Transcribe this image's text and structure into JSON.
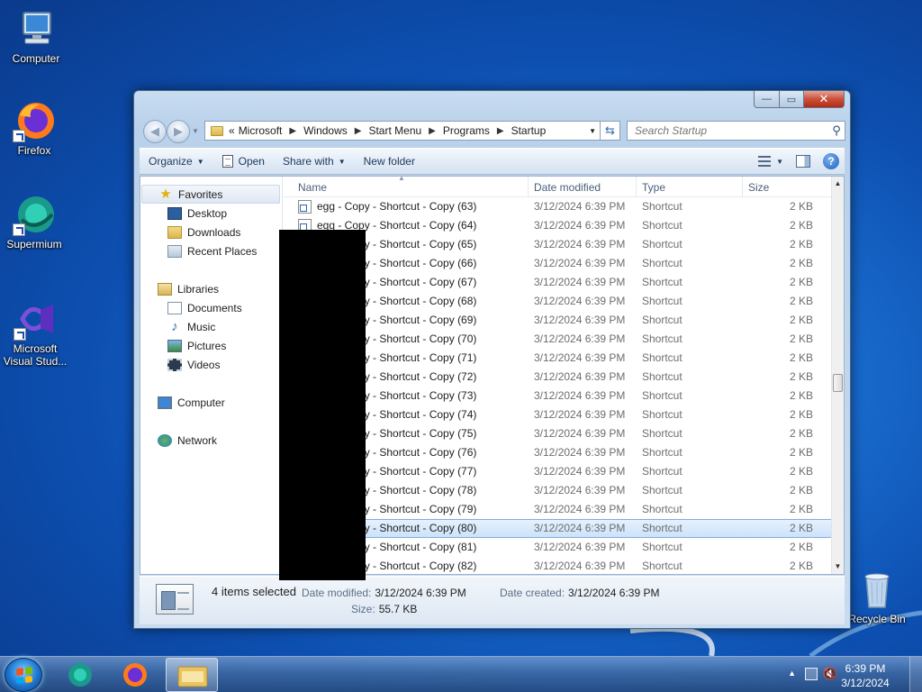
{
  "desktop": {
    "icons": [
      {
        "label": "Computer",
        "icon": "computer-icon"
      },
      {
        "label": "Firefox",
        "icon": "firefox-icon"
      },
      {
        "label": "Supermium",
        "icon": "supermium-icon"
      },
      {
        "label": "Microsoft Visual Stud...",
        "icon": "visual-studio-icon"
      },
      {
        "label": "Recycle Bin",
        "icon": "recycle-bin-icon"
      }
    ]
  },
  "window": {
    "caption": {
      "minimize": "—",
      "maximize": "▭",
      "close": "✕"
    },
    "address": {
      "overflow": "«",
      "crumbs": [
        "Microsoft",
        "Windows",
        "Start Menu",
        "Programs",
        "Startup"
      ]
    },
    "search_placeholder": "Search Startup",
    "toolbar": {
      "organize": "Organize",
      "open": "Open",
      "share_with": "Share with",
      "new_folder": "New folder"
    },
    "nav_pane": {
      "favorites": "Favorites",
      "favorites_items": [
        "Desktop",
        "Downloads",
        "Recent Places"
      ],
      "libraries": "Libraries",
      "libraries_items": [
        "Documents",
        "Music",
        "Pictures",
        "Videos"
      ],
      "computer": "Computer",
      "network": "Network"
    },
    "columns": {
      "name": "Name",
      "date": "Date modified",
      "type": "Type",
      "size": "Size"
    },
    "files": [
      {
        "name": "egg - Copy - Shortcut - Copy (63)",
        "date": "3/12/2024 6:39 PM",
        "type": "Shortcut",
        "size": "2 KB"
      },
      {
        "name": "egg - Copy - Shortcut - Copy (64)",
        "date": "3/12/2024 6:39 PM",
        "type": "Shortcut",
        "size": "2 KB"
      },
      {
        "name": "egg - Copy - Shortcut - Copy (65)",
        "date": "3/12/2024 6:39 PM",
        "type": "Shortcut",
        "size": "2 KB"
      },
      {
        "name": "egg - Copy - Shortcut - Copy (66)",
        "date": "3/12/2024 6:39 PM",
        "type": "Shortcut",
        "size": "2 KB"
      },
      {
        "name": "egg - Copy - Shortcut - Copy (67)",
        "date": "3/12/2024 6:39 PM",
        "type": "Shortcut",
        "size": "2 KB"
      },
      {
        "name": "egg - Copy - Shortcut - Copy (68)",
        "date": "3/12/2024 6:39 PM",
        "type": "Shortcut",
        "size": "2 KB"
      },
      {
        "name": "egg - Copy - Shortcut - Copy (69)",
        "date": "3/12/2024 6:39 PM",
        "type": "Shortcut",
        "size": "2 KB"
      },
      {
        "name": "egg - Copy - Shortcut - Copy (70)",
        "date": "3/12/2024 6:39 PM",
        "type": "Shortcut",
        "size": "2 KB"
      },
      {
        "name": "egg - Copy - Shortcut - Copy (71)",
        "date": "3/12/2024 6:39 PM",
        "type": "Shortcut",
        "size": "2 KB"
      },
      {
        "name": "egg - Copy - Shortcut - Copy (72)",
        "date": "3/12/2024 6:39 PM",
        "type": "Shortcut",
        "size": "2 KB"
      },
      {
        "name": "egg - Copy - Shortcut - Copy (73)",
        "date": "3/12/2024 6:39 PM",
        "type": "Shortcut",
        "size": "2 KB"
      },
      {
        "name": "egg - Copy - Shortcut - Copy (74)",
        "date": "3/12/2024 6:39 PM",
        "type": "Shortcut",
        "size": "2 KB"
      },
      {
        "name": "egg - Copy - Shortcut - Copy (75)",
        "date": "3/12/2024 6:39 PM",
        "type": "Shortcut",
        "size": "2 KB"
      },
      {
        "name": "egg - Copy - Shortcut - Copy (76)",
        "date": "3/12/2024 6:39 PM",
        "type": "Shortcut",
        "size": "2 KB"
      },
      {
        "name": "egg - Copy - Shortcut - Copy (77)",
        "date": "3/12/2024 6:39 PM",
        "type": "Shortcut",
        "size": "2 KB"
      },
      {
        "name": "egg - Copy - Shortcut - Copy (78)",
        "date": "3/12/2024 6:39 PM",
        "type": "Shortcut",
        "size": "2 KB"
      },
      {
        "name": "egg - Copy - Shortcut - Copy (79)",
        "date": "3/12/2024 6:39 PM",
        "type": "Shortcut",
        "size": "2 KB"
      },
      {
        "name": "egg - Copy - Shortcut - Copy (80)",
        "date": "3/12/2024 6:39 PM",
        "type": "Shortcut",
        "size": "2 KB",
        "selected": true
      },
      {
        "name": "egg - Copy - Shortcut - Copy (81)",
        "date": "3/12/2024 6:39 PM",
        "type": "Shortcut",
        "size": "2 KB"
      },
      {
        "name": "egg - Copy - Shortcut - Copy (82)",
        "date": "3/12/2024 6:39 PM",
        "type": "Shortcut",
        "size": "2 KB"
      }
    ],
    "details": {
      "selected": "4 items selected",
      "date_modified_label": "Date modified:",
      "date_modified": "3/12/2024 6:39 PM",
      "date_created_label": "Date created:",
      "date_created": "3/12/2024 6:39 PM",
      "size_label": "Size:",
      "size": "55.7 KB"
    }
  },
  "taskbar": {
    "clock_time": "6:39 PM",
    "clock_date": "3/12/2024"
  },
  "colors": {
    "selection": "#cbe3fa",
    "accent": "#1d5fbd"
  }
}
